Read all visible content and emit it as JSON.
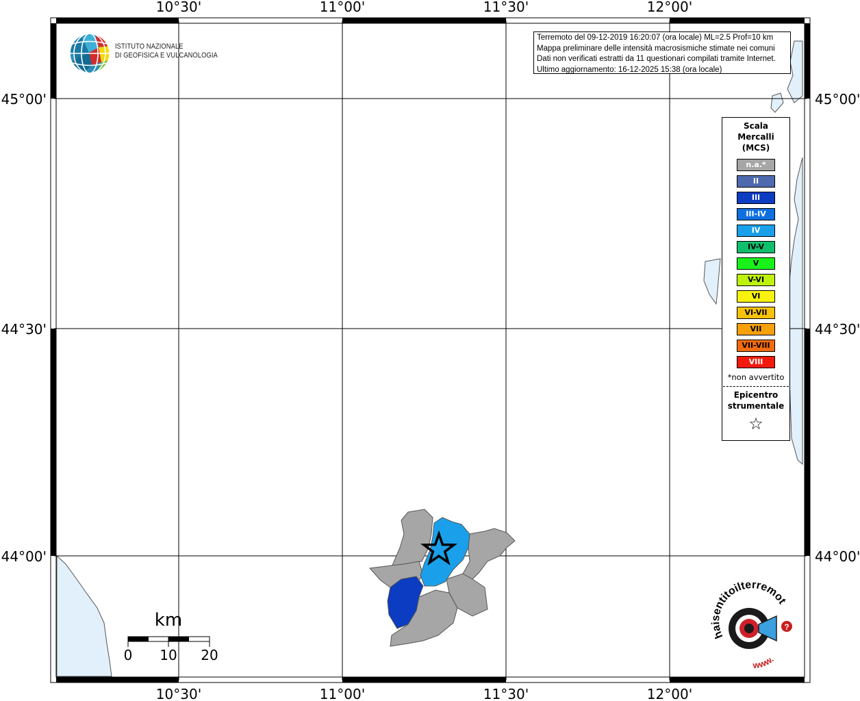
{
  "header": {
    "institute_line1": "ISTITUTO NAZIONALE",
    "institute_line2": "DI GEOFISICA E VULCANOLOGIA"
  },
  "info": {
    "line1": "Terremoto del 09-12-2019 16:20:07 (ora locale) ML=2.5 Prof=10 km",
    "line2": "Mappa preliminare delle intensità macrosismiche stimate nei comuni",
    "line3": "Dati non verificati estratti da 11 questionari compilati tramite Internet.",
    "line4": "Ultimo aggiornamento: 16-12-2025 15:38 (ora locale)"
  },
  "axes": {
    "lon_ticks": [
      "10°30'",
      "11°00'",
      "11°30'",
      "12°00'"
    ],
    "lat_ticks": [
      "45°00'",
      "44°30'",
      "44°00'"
    ]
  },
  "legend": {
    "title_line1": "Scala",
    "title_line2": "Mercalli",
    "title_line3": "(MCS)",
    "items": [
      {
        "label": "n.a.*",
        "color": "#a6a6a6",
        "text_color": "#ffffff"
      },
      {
        "label": "II",
        "color": "#4f6aae",
        "text_color": "#ffffff"
      },
      {
        "label": "III",
        "color": "#0b3cc1",
        "text_color": "#ffffff"
      },
      {
        "label": "III-IV",
        "color": "#0f6fe0",
        "text_color": "#ffffff"
      },
      {
        "label": "IV",
        "color": "#1aa0ea",
        "text_color": "#ffffff"
      },
      {
        "label": "IV-V",
        "color": "#10bf6c",
        "text_color": "#000000"
      },
      {
        "label": "V",
        "color": "#18f21a",
        "text_color": "#000000"
      },
      {
        "label": "V-VI",
        "color": "#bdf20c",
        "text_color": "#000000"
      },
      {
        "label": "VI",
        "color": "#f8f20e",
        "text_color": "#000000"
      },
      {
        "label": "VI-VII",
        "color": "#f6c20a",
        "text_color": "#000000"
      },
      {
        "label": "VII",
        "color": "#f6a00a",
        "text_color": "#000000"
      },
      {
        "label": "VII-VIII",
        "color": "#f36c0f",
        "text_color": "#000000"
      },
      {
        "label": "VIII",
        "color": "#f21a0c",
        "text_color": "#ffffff"
      }
    ],
    "note": "*non avvertito",
    "epicenter_line1": "Epicentro",
    "epicenter_line2": "strumentale",
    "epicenter_symbol": "☆"
  },
  "scalebar": {
    "unit": "km",
    "labels": [
      "0",
      "10",
      "20"
    ]
  },
  "haisentito_logo": {
    "text_main": "haisentitoilterremoto.it",
    "text_www": "www.",
    "mark": "?"
  },
  "colors": {
    "sea": "#e1f0fb",
    "not_felt": "#a6a6a6",
    "intensity_III": "#0b3cc1",
    "intensity_IV": "#1aa0ea"
  },
  "map": {
    "intensity_areas": [
      "n.a.*",
      "III",
      "IV"
    ]
  }
}
